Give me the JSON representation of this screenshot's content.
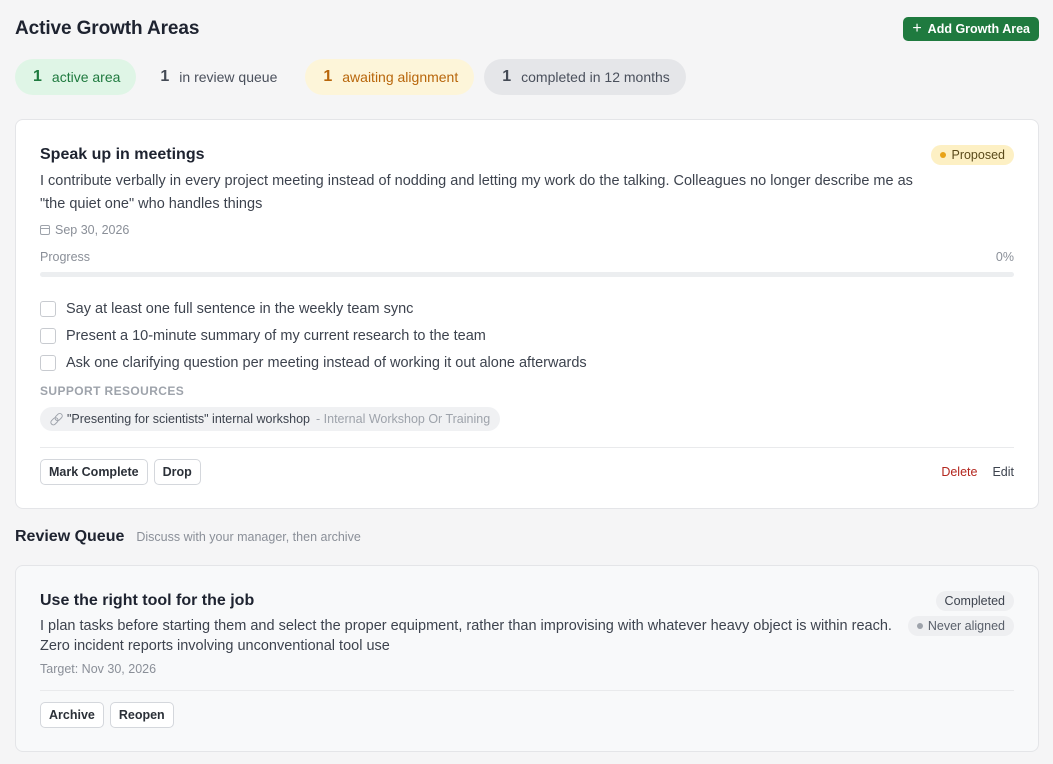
{
  "header": {
    "title": "Active Growth Areas",
    "add_button_label": "Add Growth Area"
  },
  "stats": [
    {
      "num": "1",
      "label": "active area"
    },
    {
      "num": "1",
      "label": "in review queue"
    },
    {
      "num": "1",
      "label": "awaiting alignment"
    },
    {
      "num": "1",
      "label": "completed in 12 months"
    }
  ],
  "active_card": {
    "title": "Speak up in meetings",
    "status": "Proposed",
    "description": "I contribute verbally in every project meeting instead of nodding and letting my work do the talking. Colleagues no longer describe me as \"the quiet one\" who handles things",
    "date": "Sep 30, 2026",
    "progress_label": "Progress",
    "progress_text": "0%",
    "progress_value": 0,
    "checklist": [
      "Say at least one full sentence in the weekly team sync",
      "Present a 10-minute summary of my current research to the team",
      "Ask one clarifying question per meeting instead of working it out alone afterwards"
    ],
    "resources_label": "SUPPORT RESOURCES",
    "resource": {
      "title": "\"Presenting for scientists\" internal workshop",
      "type": "- Internal Workshop Or Training"
    },
    "mark_complete_label": "Mark Complete",
    "drop_label": "Drop",
    "delete_label": "Delete",
    "edit_label": "Edit"
  },
  "review": {
    "title": "Review Queue",
    "subtitle": "Discuss with your manager, then archive"
  },
  "review_card": {
    "title": "Use the right tool for the job",
    "status": "Completed",
    "alignment": "Never aligned",
    "description": "I plan tasks before starting them and select the proper equipment, rather than improvising with whatever heavy object is within reach. Zero incident reports involving unconventional tool use",
    "target": "Target: Nov 30, 2026",
    "archive_label": "Archive",
    "reopen_label": "Reopen"
  }
}
